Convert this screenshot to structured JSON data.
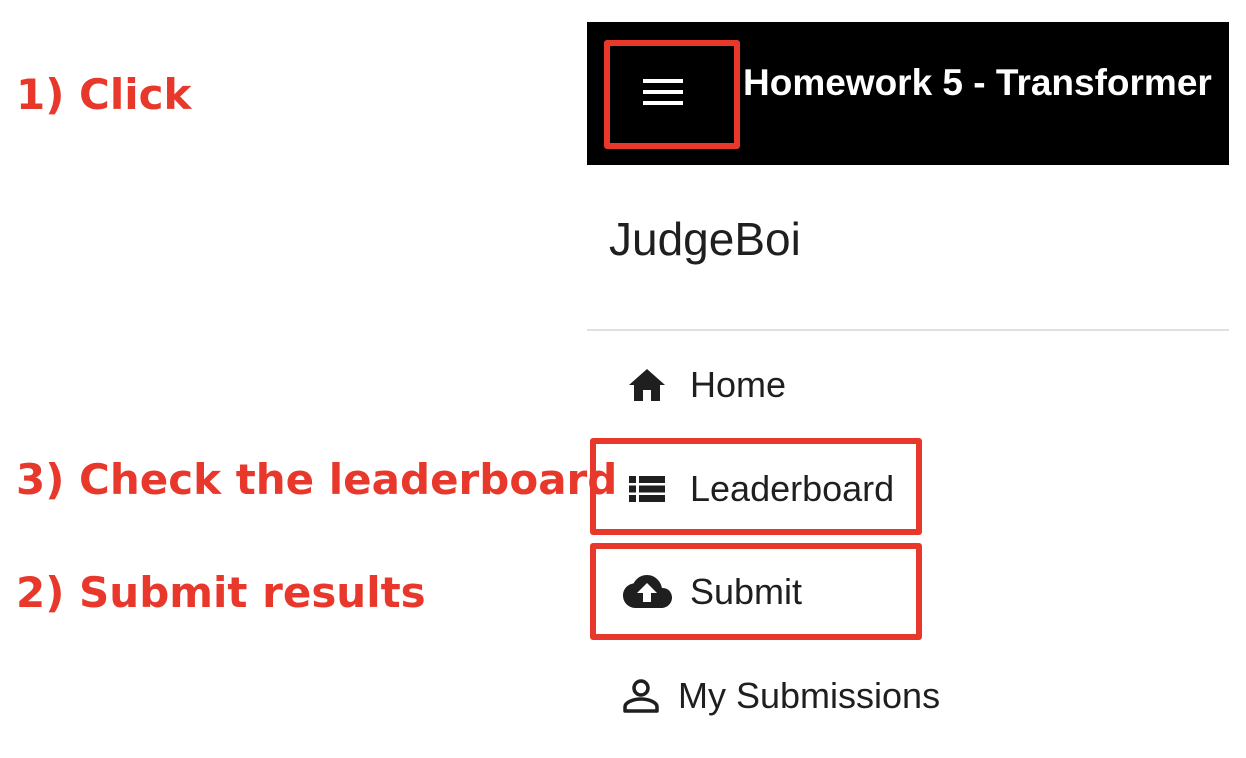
{
  "annotations": {
    "step1": "1) Click",
    "step3": "3) Check the leaderboard",
    "step2": "2) Submit results",
    "color": "#e8382b"
  },
  "topbar": {
    "title": "Homework 5 - Transformer",
    "menu_icon": "hamburger-menu-icon",
    "background": "#000000"
  },
  "drawer": {
    "title": "JudgeBoi",
    "items": [
      {
        "label": "Home",
        "icon": "home-icon"
      },
      {
        "label": "Leaderboard",
        "icon": "list-icon"
      },
      {
        "label": "Submit",
        "icon": "cloud-upload-icon"
      },
      {
        "label": "My Submissions",
        "icon": "person-icon"
      }
    ]
  }
}
